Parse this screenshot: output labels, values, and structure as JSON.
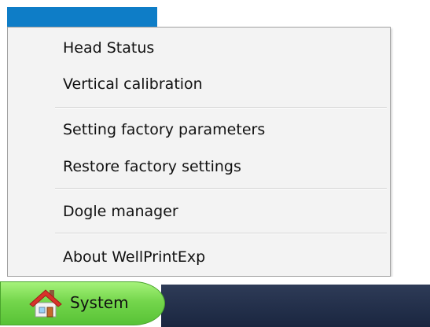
{
  "menu": {
    "items": [
      {
        "label": "Head Status"
      },
      {
        "label": "Vertical calibration"
      },
      {
        "label": "Setting factory parameters"
      },
      {
        "label": "Restore factory settings"
      },
      {
        "label": "Dogle manager"
      },
      {
        "label": "About WellPrintExp"
      }
    ]
  },
  "taskbar": {
    "start_label": "System",
    "start_icon": "home-icon"
  },
  "colors": {
    "highlight": "#0e7dc7",
    "start_button": "#74d64c",
    "taskbar": "#1f2b45"
  }
}
